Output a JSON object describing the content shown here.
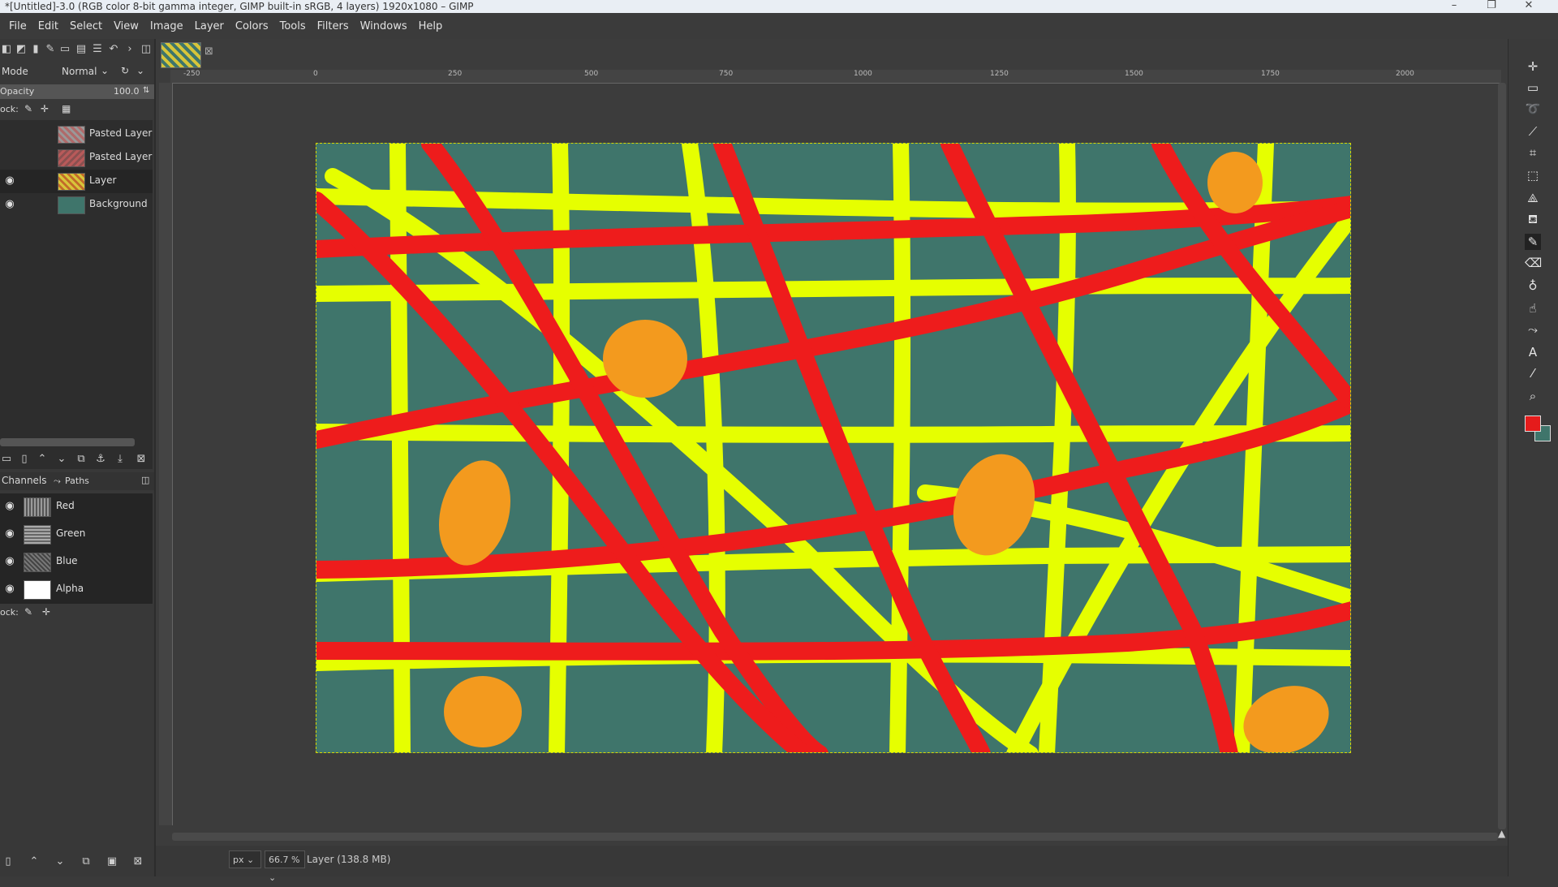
{
  "window": {
    "title": "*[Untitled]-3.0 (RGB color 8-bit gamma integer, GIMP built-in sRGB, 4 layers) 1920x1080 – GIMP",
    "minimize": "–",
    "maximize": "❐",
    "close": "✕"
  },
  "menu": [
    "File",
    "Edit",
    "Select",
    "View",
    "Image",
    "Layer",
    "Colors",
    "Tools",
    "Filters",
    "Windows",
    "Help"
  ],
  "layers_panel": {
    "mode_label": "Mode",
    "mode_value": "Normal",
    "opacity_label": "Opacity",
    "opacity_value": "100.0",
    "lock_label": "ock:",
    "layers": [
      {
        "name": "Pasted Layer",
        "visible": false,
        "thumb_color": "#b06a6a"
      },
      {
        "name": "Pasted Layer",
        "visible": false,
        "thumb_color": "#b85a5a"
      },
      {
        "name": "Layer",
        "visible": true,
        "thumb_color": "#c8b838"
      },
      {
        "name": "Background",
        "visible": true,
        "thumb_color": "#3f756b"
      }
    ]
  },
  "channels_panel": {
    "tab_channels": "Channels",
    "tab_paths": "Paths",
    "lock_label": "ock:",
    "channels": [
      {
        "name": "Red",
        "thumb_color": "#9a9a9a"
      },
      {
        "name": "Green",
        "thumb_color": "#aaaaaa"
      },
      {
        "name": "Blue",
        "thumb_color": "#777777"
      },
      {
        "name": "Alpha",
        "thumb_color": "#ffffff"
      }
    ]
  },
  "rulers": {
    "top_labels": [
      "-250",
      "0",
      "250",
      "500",
      "750",
      "1000",
      "1250",
      "1500",
      "1750",
      "2000"
    ]
  },
  "status": {
    "unit": "px",
    "zoom": "66.7 %",
    "layer_info": "Layer (138.8 MB)"
  },
  "colors": {
    "canvas_bg": "#3f756b",
    "yellow_stroke": "#e6ff00",
    "red_stroke": "#ee1c1c",
    "orange_blob": "#f39a1e",
    "fg_color": "#e51b1b",
    "bg_color": "#3f756b"
  },
  "tools": [
    "move-icon",
    "rect-select-icon",
    "lasso-icon",
    "fuzzy-select-icon",
    "crop-icon",
    "unified-transform-icon",
    "warp-icon",
    "bucket-fill-icon",
    "paintbrush-icon",
    "eraser-icon",
    "clone-icon",
    "smudge-icon",
    "paths-icon",
    "text-icon",
    "color-picker-icon",
    "zoom-icon"
  ]
}
